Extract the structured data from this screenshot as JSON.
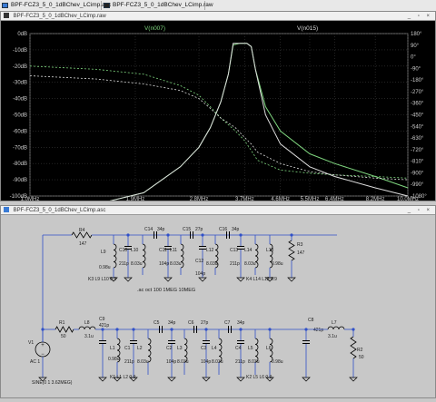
{
  "tabs": [
    {
      "label": "BPF-FCZ3_5_0_1dBChev_LCimp.asc",
      "icon": "schematic-icon"
    },
    {
      "label": "BPF-FCZ3_5_0_1dBChev_LCimp.raw",
      "icon": "waveform-icon"
    }
  ],
  "plot_window": {
    "title": "BPF-FCZ3_5_0_1dBChev_LCimp.raw",
    "traces": [
      "V(n007)",
      "V(n015)"
    ]
  },
  "schematic_window": {
    "title": "BPF-FCZ3_5_0_1dBChev_LCimp.asc",
    "labels": {
      "r4": "R4",
      "r4v": "147",
      "l9": "L9",
      "l9v": "0.98u",
      "c14": "C14",
      "c14v": "34p",
      "c15": "C15",
      "c15v": "27p",
      "c16": "C16",
      "c16v": "34p",
      "c10": "C10",
      "c10v": "211p",
      "l10": "L10",
      "l10v": "8.03u",
      "c11": "C11",
      "c11v": "104p",
      "l11": "L11",
      "l11v": "8.03u",
      "c12": "C12",
      "c12v": "104p",
      "l12": "L12",
      "l12v": "8.03u",
      "c13": "C13",
      "c13v": "211p",
      "l14": "L14",
      "l14v": "8.03u",
      "l13": "L13",
      "l13v": "0.98u",
      "r3": "R3",
      "r3v": "147",
      "k3": "K3 L9 L10 0.9",
      "k4": "K4 L14 L13 0.9",
      "ac_cmd": ".ac oct 100 1MEG 10MEG",
      "r1": "R1",
      "r1v": "50",
      "l8": "L8",
      "l8v": "3.1u",
      "c9": "C9",
      "c9v": "421p",
      "v1": "V1",
      "ac1": "AC 1",
      "sine": "SINE(0 1 3.62MEG)",
      "l1": "L1",
      "l1v": "0.98u",
      "c1": "C1",
      "c1v": "211p",
      "l2": "L2",
      "l2v": "8.03u",
      "c5": "C5",
      "c5v": "34p",
      "c2": "C2",
      "c2v": "104p",
      "l3": "L3",
      "l3v": "8.03u",
      "c6": "C6",
      "c6v": "27p",
      "c3": "C3",
      "c3v": "104p",
      "l4": "L4",
      "l4v": "8.03u",
      "c7": "C7",
      "c7v": "34p",
      "c4": "C4",
      "c4v": "211p",
      "l5": "L5",
      "l5v": "8.03u",
      "l6": "L6",
      "l6v": "0.98u",
      "c8": "C8",
      "c8v": "421p",
      "l7": "L7",
      "l7v": "3.1u",
      "r2": "R2",
      "r2v": "50",
      "k1": "K1 L1 L2 0.9",
      "k2": "K2 L5 L6 0.9"
    }
  },
  "chart_data": {
    "type": "line",
    "x_scale": "log",
    "xlim": [
      1000000,
      10000000
    ],
    "x_ticks": [
      "1.0MHz",
      "1.9MHz",
      "2.8MHz",
      "3.7MHz",
      "4.6MHz",
      "5.5MHz",
      "6.4MHz",
      "8.2MHz",
      "10.0MHz"
    ],
    "x_tick_values": [
      1.0,
      1.9,
      2.8,
      3.7,
      4.6,
      5.5,
      6.4,
      8.2,
      10.0
    ],
    "y_left_ticks": [
      "0dB",
      "-10dB",
      "-20dB",
      "-30dB",
      "-40dB",
      "-50dB",
      "-60dB",
      "-70dB",
      "-80dB",
      "-90dB",
      "-100dB"
    ],
    "y_left_lim": [
      -100,
      0
    ],
    "y_right_ticks": [
      "180°",
      "90°",
      "0°",
      "-90°",
      "-180°",
      "-270°",
      "-360°",
      "-450°",
      "-540°",
      "-630°",
      "-720°",
      "-810°",
      "-900°",
      "-990°",
      "-1080°"
    ],
    "y_right_lim": [
      -1080,
      180
    ],
    "grid": true,
    "series": [
      {
        "name": "V(n007)",
        "color": "#7fd67f",
        "x": [
          1.0,
          1.5,
          2.0,
          2.5,
          2.8,
          3.0,
          3.2,
          3.35,
          3.45,
          3.6,
          3.75,
          3.85,
          3.95,
          4.2,
          4.6,
          5.5,
          6.4,
          8.2,
          10.0
        ],
        "values": [
          -130,
          -113,
          -98,
          -82,
          -70,
          -58,
          -42,
          -25,
          -7,
          -6,
          -6,
          -8,
          -22,
          -45,
          -60,
          -74,
          -80,
          -88,
          -95
        ]
      },
      {
        "name": "V(n015)",
        "color": "#dcdcdc",
        "x": [
          1.0,
          1.5,
          2.0,
          2.5,
          2.8,
          3.0,
          3.2,
          3.35,
          3.45,
          3.6,
          3.75,
          3.85,
          3.95,
          4.2,
          4.6,
          5.5,
          6.4,
          8.2,
          10.0
        ],
        "values": [
          -130,
          -113,
          -98,
          -82,
          -70,
          -58,
          -42,
          -25,
          -6,
          -6,
          -6,
          -8,
          -22,
          -50,
          -68,
          -82,
          -88,
          -95,
          -100
        ]
      }
    ]
  }
}
